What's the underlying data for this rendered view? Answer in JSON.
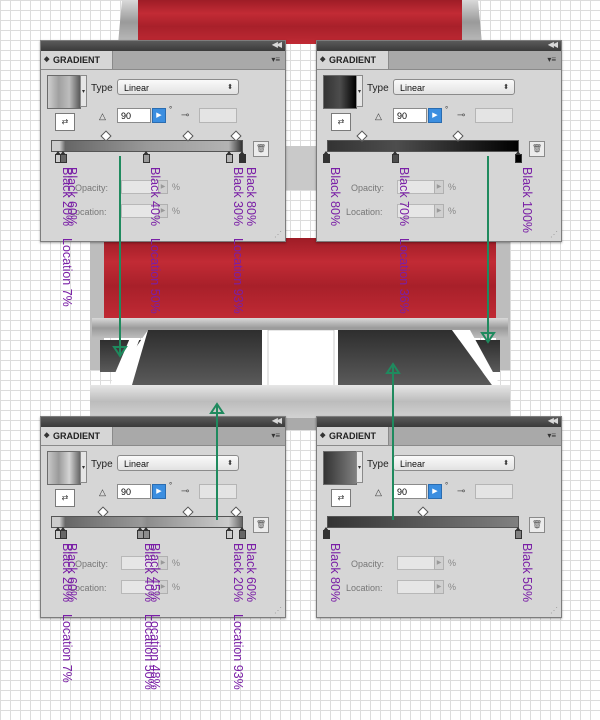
{
  "panels": [
    {
      "title": "GRADIENT",
      "type_label": "Type",
      "type_value": "Linear",
      "angle": "90",
      "degree_symbol": "°",
      "opacity_label": "Opacity:",
      "location_label": "Location:",
      "percent": "%",
      "ramp_colors": [
        "#cfcfcf",
        "#a0a0a0",
        "#bdbdbd",
        "#5a5a5a"
      ],
      "stops": [
        {
          "label": "Black 20%",
          "location": "Location 7%",
          "color": "#cccccc",
          "pos": 0.04
        },
        {
          "label": "Black 60%",
          "location": "",
          "color": "#666666",
          "pos": 0.07
        },
        {
          "label": "Black 40%",
          "location": "Location 50%",
          "color": "#999999",
          "pos": 0.5
        },
        {
          "label": "Black 30%",
          "location": "Location 93%",
          "color": "#b3b3b3",
          "pos": 0.93
        },
        {
          "label": "Black 80%",
          "location": "",
          "color": "#333333",
          "pos": 1.0
        }
      ]
    },
    {
      "title": "GRADIENT",
      "type_label": "Type",
      "type_value": "Linear",
      "angle": "90",
      "degree_symbol": "°",
      "opacity_label": "Opacity:",
      "location_label": "Location:",
      "percent": "%",
      "ramp_colors": [
        "#333333",
        "#4d4d4d",
        "#000000"
      ],
      "stops": [
        {
          "label": "Black 80%",
          "location": "",
          "color": "#333333",
          "pos": 0.0
        },
        {
          "label": "Black 70%",
          "location": "Location 36%",
          "color": "#4d4d4d",
          "pos": 0.36
        },
        {
          "label": "Black 100%",
          "location": "",
          "color": "#000000",
          "pos": 1.0
        }
      ]
    },
    {
      "title": "GRADIENT",
      "type_label": "Type",
      "type_value": "Linear",
      "angle": "90",
      "degree_symbol": "°",
      "opacity_label": "Opacity:",
      "location_label": "Location:",
      "percent": "%",
      "ramp_colors": [
        "#c8c8c8",
        "#9a9a9a",
        "#d4d4d4",
        "#666666"
      ],
      "stops": [
        {
          "label": "Black 20%",
          "location": "Location 7%",
          "color": "#cccccc",
          "pos": 0.04
        },
        {
          "label": "Black 60%",
          "location": "",
          "color": "#666666",
          "pos": 0.07
        },
        {
          "label": "Black 40%",
          "location": "Location 50%",
          "color": "#999999",
          "pos": 0.47
        },
        {
          "label": "Black 45%",
          "location": "Location 48%",
          "color": "#8c8c8c",
          "pos": 0.5
        },
        {
          "label": "Black 20%",
          "location": "Location 93%",
          "color": "#cccccc",
          "pos": 0.93
        },
        {
          "label": "Black 60%",
          "location": "",
          "color": "#666666",
          "pos": 1.0
        }
      ]
    },
    {
      "title": "GRADIENT",
      "type_label": "Type",
      "type_value": "Linear",
      "angle": "90",
      "degree_symbol": "°",
      "opacity_label": "Opacity:",
      "location_label": "Location:",
      "percent": "%",
      "ramp_colors": [
        "#333333",
        "#808080"
      ],
      "stops": [
        {
          "label": "Black 80%",
          "location": "",
          "color": "#333333",
          "pos": 0.0
        },
        {
          "label": "Black 50%",
          "location": "",
          "color": "#808080",
          "pos": 1.0
        }
      ]
    }
  ],
  "colors": {
    "accent_red": "#b3242e",
    "arrow_green": "#1f8a5e",
    "annotation_purple": "#7a1fa6"
  }
}
